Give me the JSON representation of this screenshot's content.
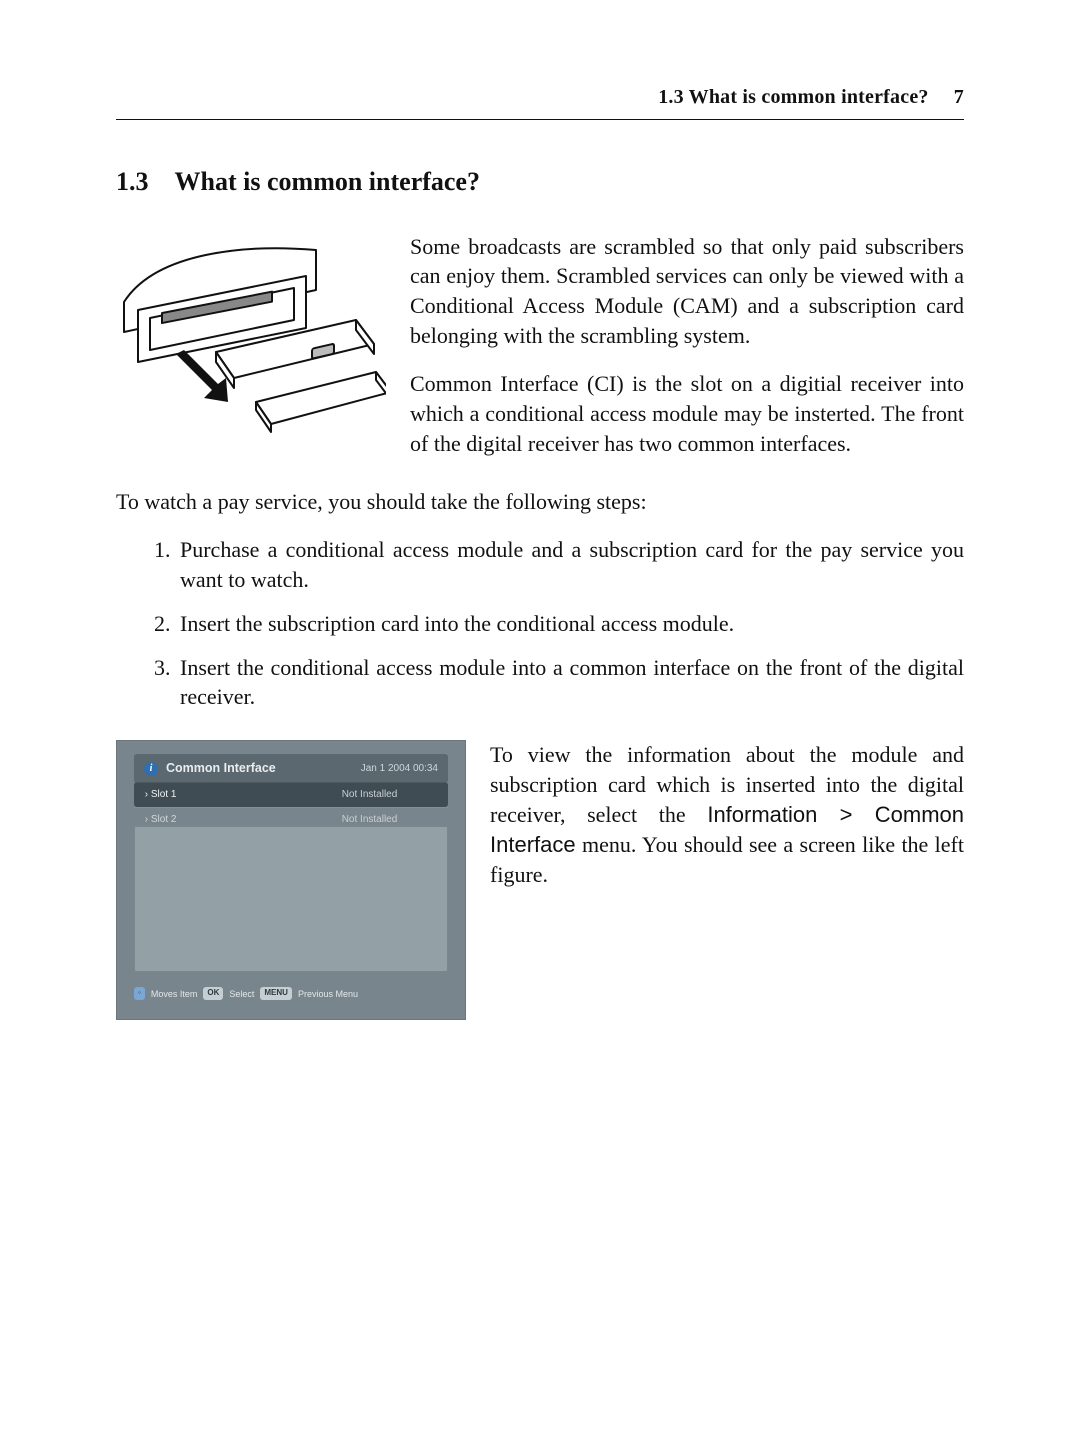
{
  "running_head": {
    "label": "1.3 What is common interface?",
    "page_number": "7"
  },
  "section": {
    "number": "1.3",
    "title": "What is common interface?"
  },
  "paragraphs": {
    "p1": "Some broadcasts are scrambled so that only paid subscribers can enjoy them. Scrambled services can only be viewed with a Conditional Access Module (CAM) and a subscription card belonging with the scrambling system.",
    "p2": "Common Interface (CI) is the slot on a digitial receiver into which a conditional access module may be insterted. The front of the digital receiver has two common interfaces.",
    "lead": "To watch a pay service, you should take the following steps:"
  },
  "steps": [
    "Purchase a conditional access module and a subscription card for the pay service you want to watch.",
    "Insert the subscription card into the conditional access module.",
    "Insert the conditional access module into a common interface on the front of the digital receiver."
  ],
  "lower": {
    "pre": "To view the information about the module and subscription card which is inserted into the digital receiver, select the ",
    "menu_a": "Information",
    "sep": " > ",
    "menu_b": "Common Interface",
    "post": " menu. You should see a screen like the left figure."
  },
  "screenshot": {
    "info_glyph": "i",
    "title": "Common Interface",
    "timestamp": "Jan 1 2004 00:34",
    "rows": [
      {
        "slot": "Slot 1",
        "status": "Not Installed"
      },
      {
        "slot": "Slot 2",
        "status": "Not Installed"
      }
    ],
    "footer": {
      "chip_nav": "◦",
      "nav_label": "Moves Item",
      "chip_ok": "OK",
      "ok_label": "Select",
      "chip_menu": "MENU",
      "menu_label": "Previous Menu"
    }
  }
}
